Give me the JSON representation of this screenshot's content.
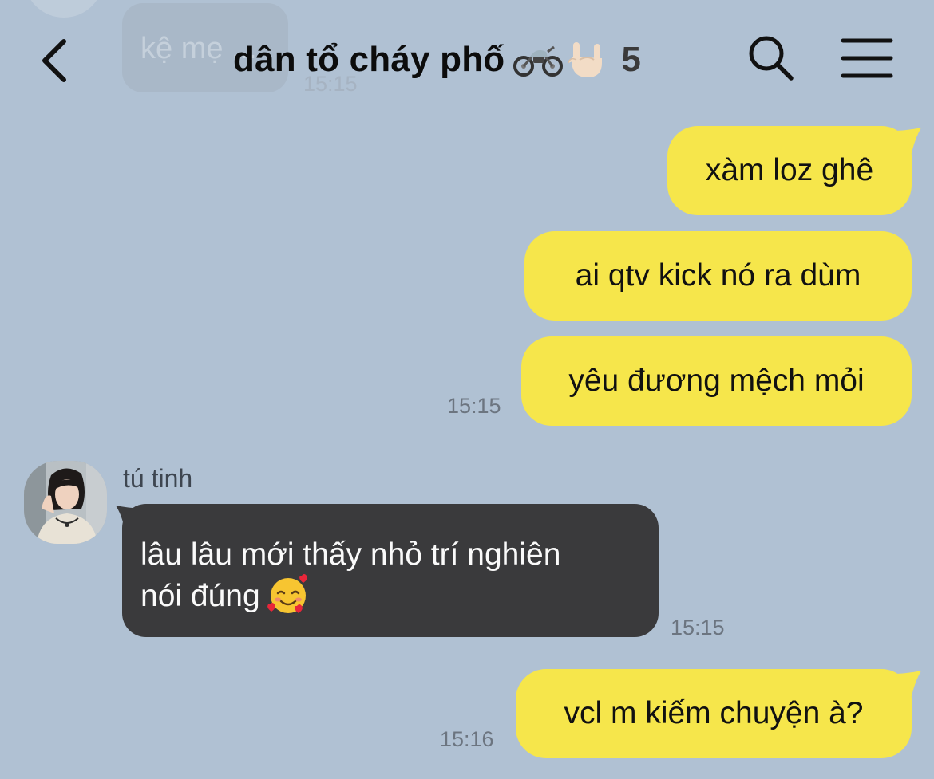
{
  "background_message": {
    "text": "kệ mẹ ...",
    "time": "15:15"
  },
  "header": {
    "title": "dân tổ cháy phố",
    "title_emojis": [
      "motorcycle-emoji",
      "rock-on-hand-emoji"
    ],
    "member_count": "5",
    "icons": {
      "back": "chevron-left-icon",
      "search": "search-icon",
      "menu": "hamburger-menu-icon"
    }
  },
  "messages": [
    {
      "direction": "outgoing",
      "text": "xàm loz ghê"
    },
    {
      "direction": "outgoing",
      "text": "ai qtv kick nó ra dùm"
    },
    {
      "direction": "outgoing",
      "text": "yêu đương mệch mỏi",
      "time": "15:15"
    },
    {
      "direction": "incoming",
      "sender": "tú tinh",
      "lines": [
        "lâu lâu mới thấy nhỏ trí nghiên",
        "nói đúng"
      ],
      "emoji": "smiling-face-with-hearts-emoji",
      "time": "15:15"
    },
    {
      "direction": "outgoing",
      "text": "vcl m kiếm chuyện à?",
      "time": "15:16"
    }
  ],
  "colors": {
    "background": "#b0c1d3",
    "outgoing_bubble": "#f6e64b",
    "incoming_bubble": "#3a3a3c",
    "timestamp": "#6c7580"
  }
}
